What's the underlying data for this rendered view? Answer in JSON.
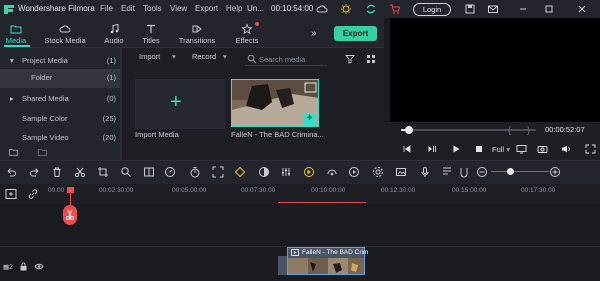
{
  "app": {
    "name": "Wondershare Filmora",
    "title": "Un...",
    "time": "00:10:54:00"
  },
  "menu": [
    "File",
    "Edit",
    "Tools",
    "View",
    "Export",
    "Help"
  ],
  "login_label": "Login",
  "tabs": [
    {
      "label": "Media",
      "icon": "folder-icon"
    },
    {
      "label": "Stock Media",
      "icon": "cloud-icon"
    },
    {
      "label": "Audio",
      "icon": "music-note-icon"
    },
    {
      "label": "Titles",
      "icon": "text-icon"
    },
    {
      "label": "Transitions",
      "icon": "transition-icon"
    },
    {
      "label": "Effects",
      "icon": "effects-icon"
    }
  ],
  "export_label": "Export",
  "sidebar": {
    "items": [
      {
        "label": "Project Media",
        "count": "(1)"
      },
      {
        "label": "Folder",
        "count": "(1)"
      },
      {
        "label": "Shared Media",
        "count": "(0)"
      },
      {
        "label": "Sample Color",
        "count": "(25)"
      },
      {
        "label": "Sample Video",
        "count": "(20)"
      }
    ]
  },
  "media": {
    "import_dropdown": "Import",
    "record_dropdown": "Record",
    "search_placeholder": "Search media",
    "import_label": "Import Media",
    "clip_label": "FalleN - The BAD Crimina..."
  },
  "preview": {
    "time": "00:00:52:07",
    "quality": "Full",
    "progress": 0.05
  },
  "ruler": [
    "00:00",
    "00:02:30:00",
    "00:05:00:00",
    "00:07:30:00",
    "00:10:00:00",
    "00:12:30:00",
    "00:15:00:00",
    "00:17:30:00"
  ],
  "timeline_clip": "FalleN - The BAD Crim",
  "colors": {
    "accent": "#2fe0c8",
    "export": "#36d0a2",
    "playhead": "#ef4b4b"
  }
}
